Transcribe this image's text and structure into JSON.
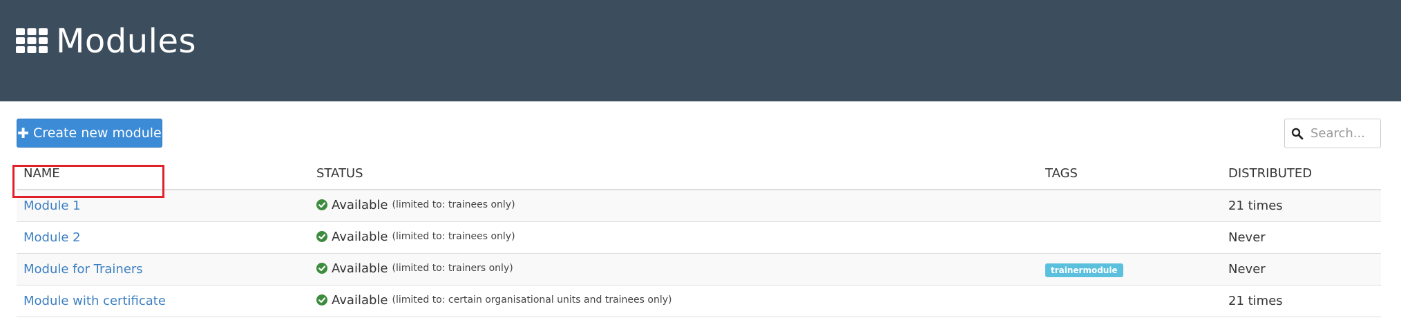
{
  "header": {
    "title": "Modules",
    "icon": "grid-icon"
  },
  "toolbar": {
    "create_label": "Create new module",
    "search_placeholder": "Search..."
  },
  "table": {
    "columns": [
      "NAME",
      "STATUS",
      "TAGS",
      "DISTRIBUTED"
    ],
    "rows": [
      {
        "name": "Module 1",
        "status": "Available",
        "limit": "(limited to: trainees only)",
        "tag": "",
        "distributed": "21 times"
      },
      {
        "name": "Module 2",
        "status": "Available",
        "limit": "(limited to: trainees only)",
        "tag": "",
        "distributed": "Never"
      },
      {
        "name": "Module for Trainers",
        "status": "Available",
        "limit": "(limited to: trainers only)",
        "tag": "trainermodule",
        "distributed": "Never"
      },
      {
        "name": "Module with certificate",
        "status": "Available",
        "limit": "(limited to: certain organisational units and trainees only)",
        "tag": "",
        "distributed": "21 times"
      }
    ]
  },
  "colors": {
    "header_bg": "#3c4e5d",
    "button_bg": "#3c8bd6",
    "link": "#3c7fc2",
    "status_ok": "#3d8b3d",
    "tag_bg": "#5bc0de",
    "highlight": "#e0202b"
  }
}
